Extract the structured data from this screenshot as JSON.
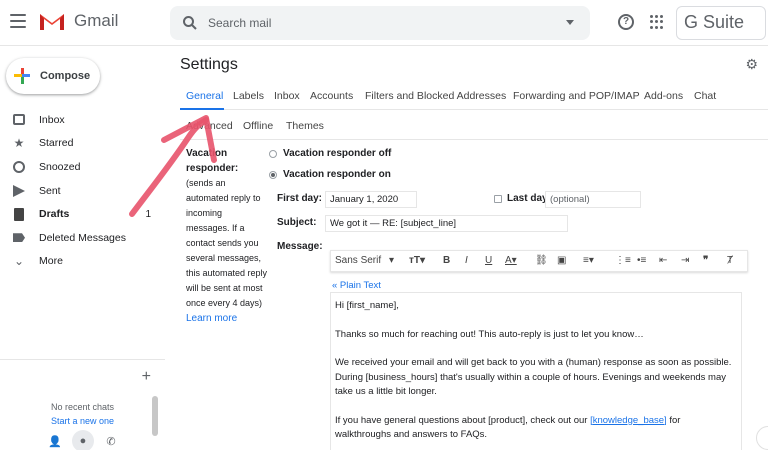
{
  "topbar": {
    "logo_text": "Gmail",
    "search_placeholder": "Search mail",
    "gsuite_label": "G Suite",
    "help_symbol": "?"
  },
  "sidebar": {
    "compose_label": "Compose",
    "items": [
      {
        "label": "Inbox",
        "icon": "inbox-icon",
        "count": ""
      },
      {
        "label": "Starred",
        "icon": "star-icon",
        "count": ""
      },
      {
        "label": "Snoozed",
        "icon": "clock-icon",
        "count": ""
      },
      {
        "label": "Sent",
        "icon": "send-icon",
        "count": ""
      },
      {
        "label": "Drafts",
        "icon": "draft-icon",
        "count": "1"
      },
      {
        "label": "Deleted Messages",
        "icon": "label-icon",
        "count": ""
      },
      {
        "label": "More",
        "icon": "chevron-down-icon",
        "count": ""
      }
    ],
    "chat": {
      "no_chats": "No recent chats",
      "start_new": "Start a new one"
    }
  },
  "settings": {
    "title": "Settings",
    "tabs_row1": [
      "General",
      "Labels",
      "Inbox",
      "Accounts",
      "Filters and Blocked Addresses",
      "Forwarding and POP/IMAP",
      "Add-ons",
      "Chat"
    ],
    "tabs_row2": [
      "Advanced",
      "Offline",
      "Themes"
    ],
    "active_tab": "General"
  },
  "vacation": {
    "heading": "Vacation responder:",
    "description": "(sends an automated reply to incoming messages. If a contact sends you several messages, this automated reply will be sent at most once every 4 days)",
    "learn_more": "Learn more",
    "option_off": "Vacation responder off",
    "option_on": "Vacation responder on",
    "first_day_label": "First day:",
    "first_day_value": "January 1, 2020",
    "last_day_label": "Last day:",
    "last_day_placeholder": "(optional)",
    "subject_label": "Subject:",
    "subject_value": "We got it — RE: [subject_line]",
    "message_label": "Message:",
    "font_name": "Sans Serif",
    "plain_text_link": "« Plain Text",
    "message_lines": [
      "Hi [first_name],",
      "Thanks so much for reaching out! This auto-reply is just to let you know…",
      "We received your email and will get back to you with a (human) response as soon as possible. During [business_hours] that's usually within a couple of hours. Evenings and weekends may take us a little bit longer."
    ],
    "faq_before": "If you have general questions about [product], check out our ",
    "faq_link": "[knowledge_base]",
    "faq_after": " for walkthroughs and answers to FAQs."
  },
  "colors": {
    "accent": "#1a73e8",
    "annotation_arrow": "#e8536b",
    "gmail_red": "#ea4335"
  }
}
